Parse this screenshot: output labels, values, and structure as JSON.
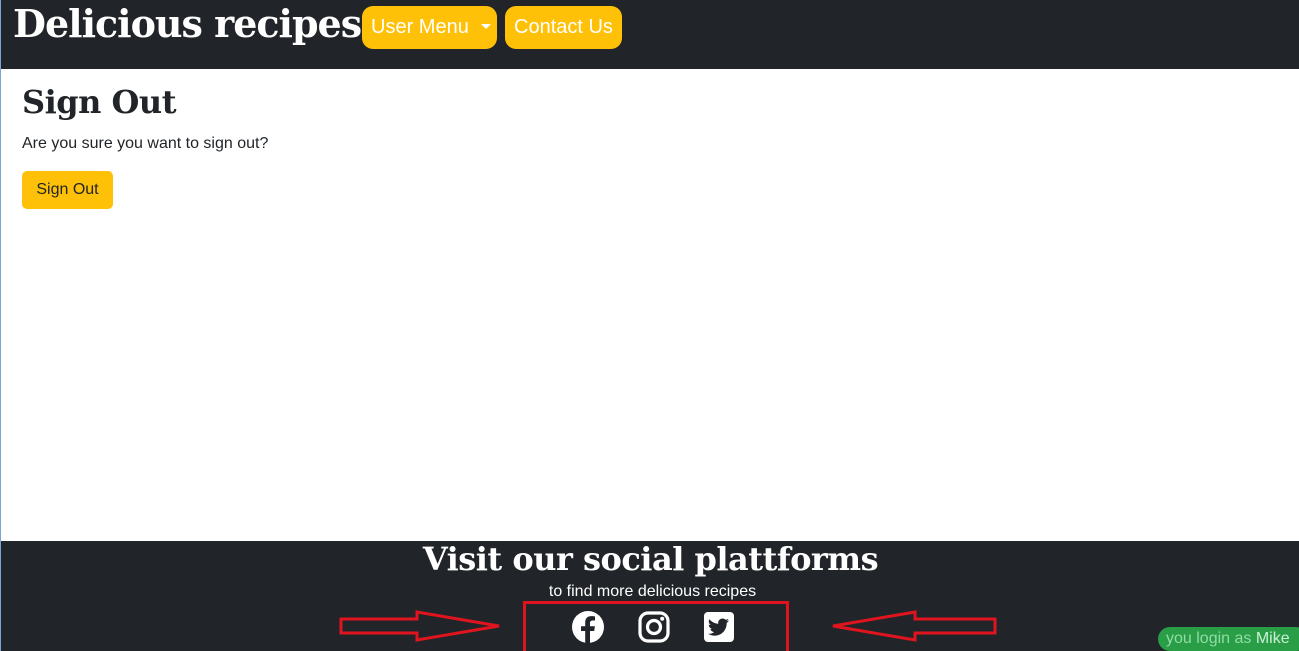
{
  "navbar": {
    "brand": "Delicious recipes",
    "user_menu_label": "User Menu",
    "contact_label": "Contact Us"
  },
  "main": {
    "title": "Sign Out",
    "message": "Are you sure you want to sign out?",
    "signout_button": "Sign Out"
  },
  "footer": {
    "title": "Visit our social plattforms",
    "subtitle": "to find more delicious recipes",
    "social_icons": [
      "facebook-icon",
      "instagram-icon",
      "twitter-icon"
    ]
  },
  "status": {
    "login_prefix": "you login as",
    "user": "Mike"
  },
  "colors": {
    "navbar_bg": "#212529",
    "accent": "#ffc107",
    "annotation": "#e0141e",
    "badge": "#2a9d47"
  }
}
